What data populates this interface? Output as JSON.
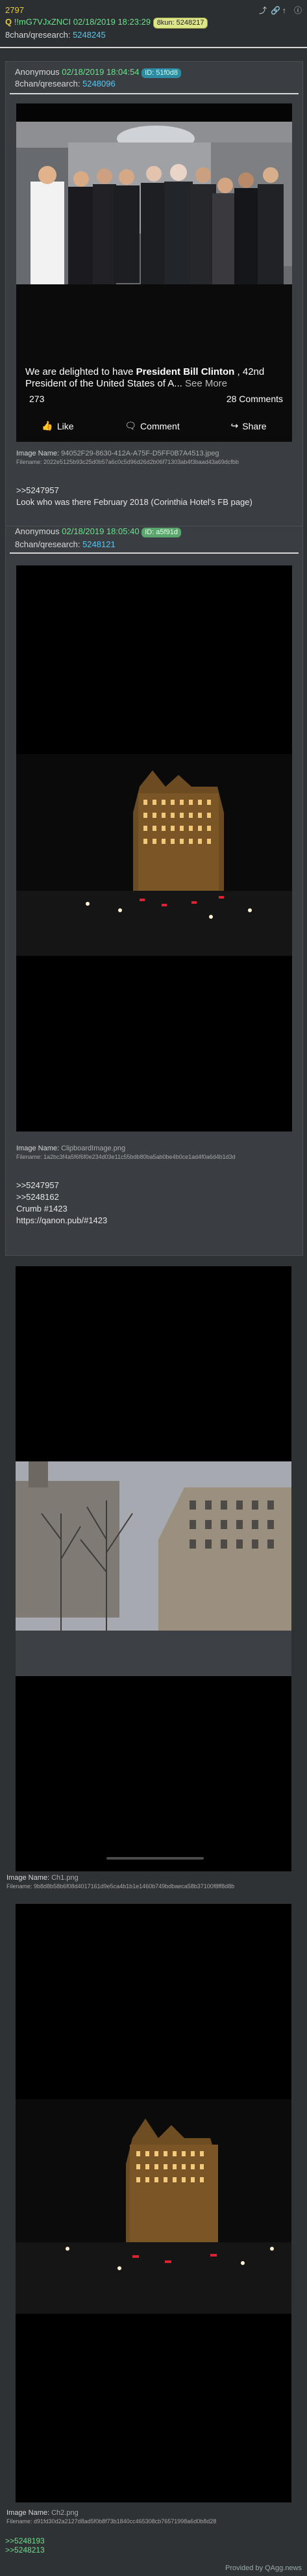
{
  "top": {
    "post_number": "2797",
    "q_icon": "Q",
    "id": "!!mG7VJxZNCI",
    "date": "02/18/2019 18:23:29",
    "badge": "8kun: 5248217",
    "board": "8chan/qresearch:",
    "link": "5248245"
  },
  "first_quote": {
    "name": "Anonymous",
    "date": "02/18/2019 18:04:54",
    "badge": "ID: 51f0d8",
    "board": "8chan/qresearch:",
    "link": "5248096",
    "image": {
      "text_line1": "We are delighted to have ",
      "text_bold": "President Bill Clinton",
      "text_line2": ", 42nd President of the United States of A...",
      "see_more": "See More",
      "reaction_count": "273",
      "comments": "28 Comments",
      "like": "Like",
      "comment": "Comment",
      "share": "Share"
    },
    "image_name_label": "Image Name:",
    "image_name": "94052F29-8630-412A-A75F-D5FF0B7A4513.jpeg",
    "filename_label": "Filename:",
    "filename": "2022e5125b93c25d0b57a6c0c5d96d26d2b06f71303ab4f3baad43a69dcfbb",
    "lines": [
      ">>5247957",
      "Look who was there February 2018 (Corinthia Hotel's FB page)"
    ]
  },
  "second_quote": {
    "name": "Anonymous",
    "date": "02/18/2019 18:05:40",
    "badge": "ID: a5f91d",
    "board": "8chan/qresearch:",
    "link": "5248121",
    "image_name_label": "Image Name:",
    "image_name": "ClipboardImage.png",
    "filename_label": "Filename:",
    "filename": "1a2bc3f4a5f6f6f0e234d03e11c55bdb80ba5ab0be4b0ce1ad4f0a6d4b1d3d",
    "lines": [
      ">>5247957",
      ">>5248162",
      "Crumb #1423",
      "https://qanon.pub/#1423"
    ]
  },
  "third": {
    "image_name_label": "Image Name:",
    "image_name": "Ch1.png",
    "filename_label": "Filename:",
    "filename": "9b8d8b58b6f08d4017161d9e5ca4b1b1e1460b749bdbaeca58b37100f8ff8d8b"
  },
  "fourth": {
    "image_name_label": "Image Name:",
    "image_name": "Ch2.png",
    "filename_label": "Filename:",
    "filename": "d91fd30d2a2127d8ad5f0b8f73b1840cc465308cb76571998a6d0b8d28"
  },
  "footer": {
    "links": [
      ">>5248193",
      ">>5248213"
    ],
    "powered": "Provided by QAgg.news"
  },
  "colors": {
    "bg": "#2f3235",
    "green": "#6de08c",
    "yellow": "#e6c940",
    "link": "#56c8f0"
  }
}
